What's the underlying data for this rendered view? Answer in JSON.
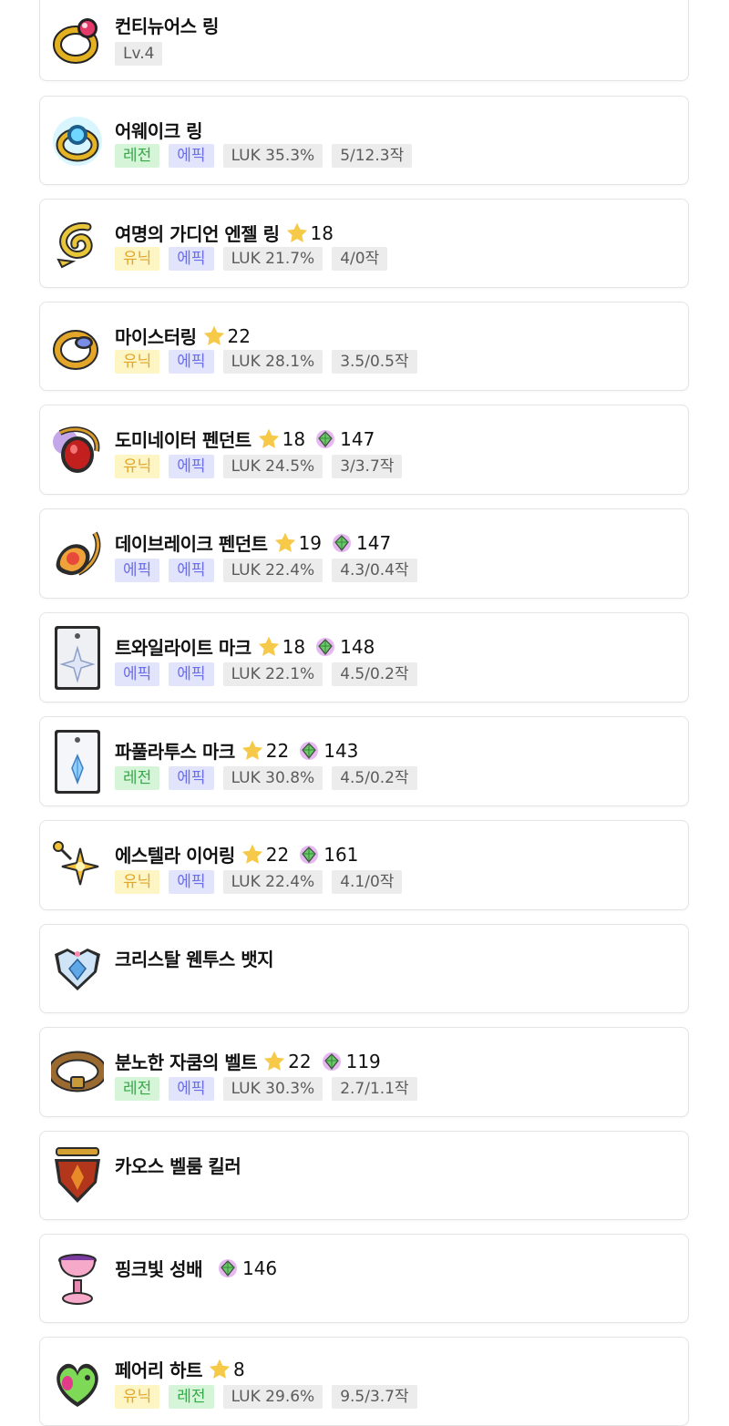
{
  "items": [
    {
      "name": "컨티뉴어스 링",
      "icon": "continuous-ring-icon",
      "tags": [
        {
          "text": "Lv.4",
          "kind": "gray"
        }
      ]
    },
    {
      "name": "어웨이크 링",
      "icon": "awake-ring-icon",
      "tags": [
        {
          "text": "레전",
          "kind": "legend"
        },
        {
          "text": "에픽",
          "kind": "epic"
        },
        {
          "text": "LUK 35.3%",
          "kind": "gray"
        },
        {
          "text": "5/12.3작",
          "kind": "gray"
        }
      ]
    },
    {
      "name": "여명의 가디언 엔젤 링",
      "icon": "guardian-angel-ring-icon",
      "star": "18",
      "tags": [
        {
          "text": "유닉",
          "kind": "unique"
        },
        {
          "text": "에픽",
          "kind": "epic"
        },
        {
          "text": "LUK 21.7%",
          "kind": "gray"
        },
        {
          "text": "4/0작",
          "kind": "gray"
        }
      ]
    },
    {
      "name": "마이스터링",
      "icon": "meister-ring-icon",
      "star": "22",
      "tags": [
        {
          "text": "유닉",
          "kind": "unique"
        },
        {
          "text": "에픽",
          "kind": "epic"
        },
        {
          "text": "LUK 28.1%",
          "kind": "gray"
        },
        {
          "text": "3.5/0.5작",
          "kind": "gray"
        }
      ]
    },
    {
      "name": "도미네이터 펜던트",
      "icon": "dominator-pendant-icon",
      "star": "18",
      "gem": "147",
      "tags": [
        {
          "text": "유닉",
          "kind": "unique"
        },
        {
          "text": "에픽",
          "kind": "epic"
        },
        {
          "text": "LUK 24.5%",
          "kind": "gray"
        },
        {
          "text": "3/3.7작",
          "kind": "gray"
        }
      ]
    },
    {
      "name": "데이브레이크 펜던트",
      "icon": "daybreak-pendant-icon",
      "star": "19",
      "gem": "147",
      "tags": [
        {
          "text": "에픽",
          "kind": "epic"
        },
        {
          "text": "에픽",
          "kind": "epic"
        },
        {
          "text": "LUK 22.4%",
          "kind": "gray"
        },
        {
          "text": "4.3/0.4작",
          "kind": "gray"
        }
      ]
    },
    {
      "name": "트와일라이트 마크",
      "icon": "twilight-mark-icon",
      "star": "18",
      "gem": "148",
      "tags": [
        {
          "text": "에픽",
          "kind": "epic"
        },
        {
          "text": "에픽",
          "kind": "epic"
        },
        {
          "text": "LUK 22.1%",
          "kind": "gray"
        },
        {
          "text": "4.5/0.2작",
          "kind": "gray"
        }
      ]
    },
    {
      "name": "파풀라투스 마크",
      "icon": "papulatus-mark-icon",
      "star": "22",
      "gem": "143",
      "tags": [
        {
          "text": "레전",
          "kind": "legend"
        },
        {
          "text": "에픽",
          "kind": "epic"
        },
        {
          "text": "LUK 30.8%",
          "kind": "gray"
        },
        {
          "text": "4.5/0.2작",
          "kind": "gray"
        }
      ]
    },
    {
      "name": "에스텔라 이어링",
      "icon": "estella-earring-icon",
      "star": "22",
      "gem": "161",
      "tags": [
        {
          "text": "유닉",
          "kind": "unique"
        },
        {
          "text": "에픽",
          "kind": "epic"
        },
        {
          "text": "LUK 22.4%",
          "kind": "gray"
        },
        {
          "text": "4.1/0작",
          "kind": "gray"
        }
      ]
    },
    {
      "name": "크리스탈 웬투스 뱃지",
      "icon": "crystal-ventus-badge-icon",
      "tags": []
    },
    {
      "name": "분노한 자쿰의 벨트",
      "icon": "zakum-belt-icon",
      "star": "22",
      "gem": "119",
      "tags": [
        {
          "text": "레전",
          "kind": "legend"
        },
        {
          "text": "에픽",
          "kind": "epic"
        },
        {
          "text": "LUK 30.3%",
          "kind": "gray"
        },
        {
          "text": "2.7/1.1작",
          "kind": "gray"
        }
      ]
    },
    {
      "name": "카오스 벨룸 킬러",
      "icon": "chaos-vellum-killer-icon",
      "tags": []
    },
    {
      "name": "핑크빛 성배",
      "icon": "pink-holy-cup-icon",
      "gem": "146",
      "tags": []
    },
    {
      "name": "페어리 하트",
      "icon": "fairy-heart-icon",
      "star": "8",
      "tags": [
        {
          "text": "유닉",
          "kind": "unique"
        },
        {
          "text": "레전",
          "kind": "legend"
        },
        {
          "text": "LUK 29.6%",
          "kind": "gray"
        },
        {
          "text": "9.5/3.7작",
          "kind": "gray"
        }
      ]
    }
  ]
}
